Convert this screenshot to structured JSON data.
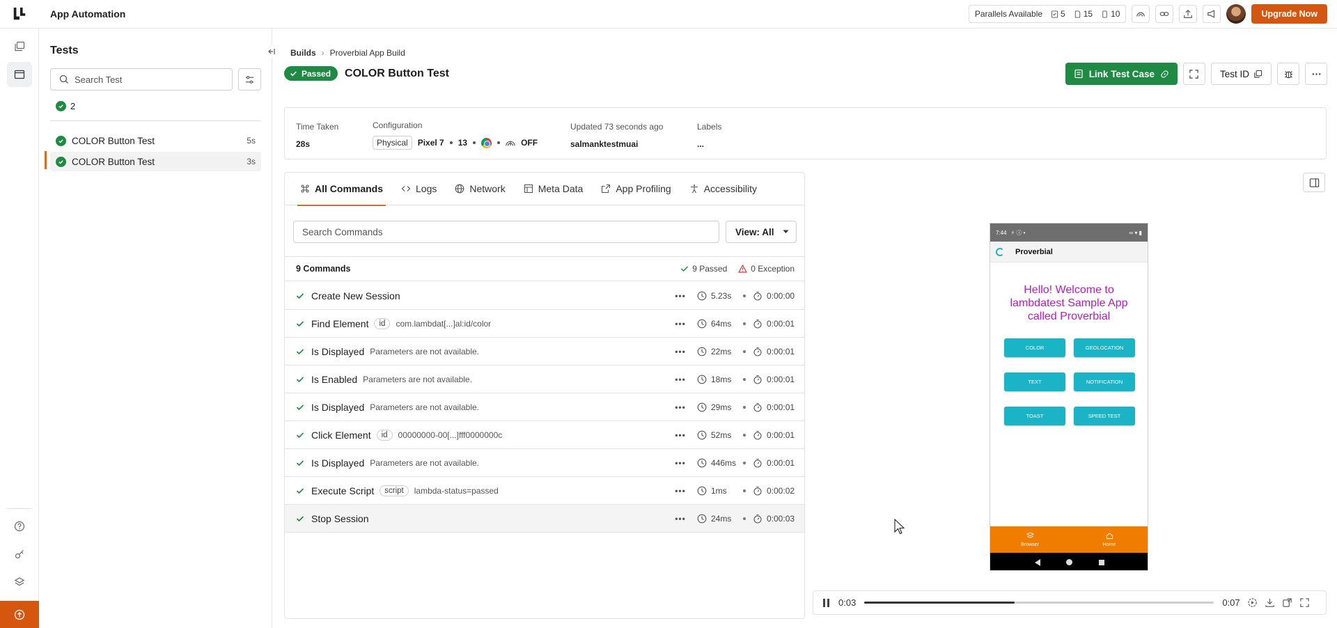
{
  "app": {
    "title": "App Automation"
  },
  "topbar": {
    "parallels_label": "Parallels Available",
    "parallels_counts": [
      "5",
      "15",
      "10"
    ],
    "upgrade_label": "Upgrade Now",
    "accent": "#d5570f"
  },
  "tests_panel": {
    "title": "Tests",
    "search_placeholder": "Search Test",
    "passed_count": "2",
    "items": [
      {
        "name": "COLOR Button Test",
        "duration": "5s"
      },
      {
        "name": "COLOR Button Test",
        "duration": "3s"
      }
    ]
  },
  "breadcrumb": {
    "builds": "Builds",
    "build_name": "Proverbial App Build"
  },
  "header": {
    "status": "Passed",
    "title": "COLOR Button Test",
    "link_test_case": "Link Test Case",
    "test_id": "Test ID",
    "status_color": "#1f8a43"
  },
  "info": {
    "time_taken_label": "Time Taken",
    "time_taken": "28s",
    "configuration_label": "Configuration",
    "device_type": "Physical",
    "device": "Pixel 7",
    "os_version": "13",
    "network": "OFF",
    "updated_label": "Updated 73 seconds ago",
    "user": "salmanktestmuai",
    "labels_label": "Labels",
    "labels_value": "..."
  },
  "tabs": [
    {
      "label": "All Commands",
      "icon": "command-icon"
    },
    {
      "label": "Logs",
      "icon": "code-icon"
    },
    {
      "label": "Network",
      "icon": "globe-icon"
    },
    {
      "label": "Meta Data",
      "icon": "table-icon"
    },
    {
      "label": "App Profiling",
      "icon": "external-icon"
    },
    {
      "label": "Accessibility",
      "icon": "accessibility-icon"
    }
  ],
  "commands": {
    "search_placeholder": "Search Commands",
    "view_label": "View: All",
    "count_label": "9 Commands",
    "passed_label": "9 Passed",
    "exception_label": "0 Exception",
    "rows": [
      {
        "name": "Create New Session",
        "tag": "",
        "param": "",
        "duration": "5.23s",
        "timestamp": "0:00:00"
      },
      {
        "name": "Find Element",
        "tag": "id",
        "param": "com.lambdat[...]al:id/color",
        "duration": "64ms",
        "timestamp": "0:00:01"
      },
      {
        "name": "Is Displayed",
        "tag": "",
        "param": "Parameters are not available.",
        "duration": "22ms",
        "timestamp": "0:00:01"
      },
      {
        "name": "Is Enabled",
        "tag": "",
        "param": "Parameters are not available.",
        "duration": "18ms",
        "timestamp": "0:00:01"
      },
      {
        "name": "Is Displayed",
        "tag": "",
        "param": "Parameters are not available.",
        "duration": "29ms",
        "timestamp": "0:00:01"
      },
      {
        "name": "Click Element",
        "tag": "id",
        "param": "00000000-00[...]fff0000000c",
        "duration": "52ms",
        "timestamp": "0:00:01"
      },
      {
        "name": "Is Displayed",
        "tag": "",
        "param": "Parameters are not available.",
        "duration": "446ms",
        "timestamp": "0:00:01"
      },
      {
        "name": "Execute Script",
        "tag": "script",
        "param": "lambda-status=passed",
        "duration": "1ms",
        "timestamp": "0:00:02"
      },
      {
        "name": "Stop Session",
        "tag": "",
        "param": "",
        "duration": "24ms",
        "timestamp": "0:00:03"
      }
    ]
  },
  "device_screen": {
    "status_time": "7:44",
    "app_name": "Proverbial",
    "welcome": "Hello! Welcome to lambdatest Sample App called Proverbial",
    "buttons": [
      "COLOR",
      "GEOLOCATION",
      "TEXT",
      "NOTIFICATION",
      "TOAST",
      "SPEED TEST"
    ],
    "nav": [
      "Browser",
      "Home"
    ]
  },
  "player": {
    "current": "0:03",
    "total": "0:07",
    "progress": 0.43
  }
}
